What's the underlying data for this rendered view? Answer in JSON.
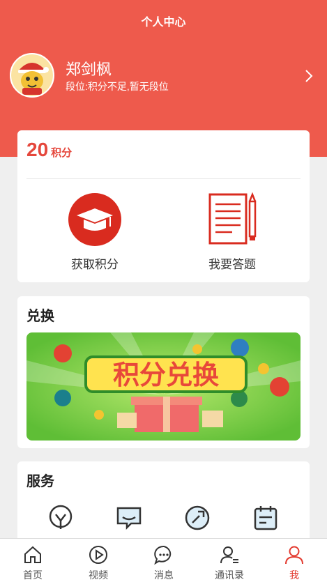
{
  "header": {
    "title": "个人中心"
  },
  "profile": {
    "name": "郑剑枫",
    "level_text": "段位:积分不足,暂无段位"
  },
  "points": {
    "value": "20",
    "unit": "积分",
    "actions": [
      {
        "label": "获取积分",
        "icon": "graduation-cap-icon"
      },
      {
        "label": "我要答题",
        "icon": "answer-sheet-icon"
      }
    ]
  },
  "exchange": {
    "title": "兑换",
    "banner_text": "积分兑换"
  },
  "service": {
    "title": "服务",
    "icons": [
      "lightbulb-icon",
      "message-icon",
      "wrench-icon",
      "calendar-icon"
    ]
  },
  "tabbar": {
    "items": [
      {
        "label": "首页",
        "icon": "home-icon"
      },
      {
        "label": "视频",
        "icon": "play-icon"
      },
      {
        "label": "消息",
        "icon": "chat-icon"
      },
      {
        "label": "通讯录",
        "icon": "contacts-icon"
      },
      {
        "label": "我",
        "icon": "user-icon"
      }
    ],
    "active_index": 4
  },
  "colors": {
    "brand": "#ee5a4c",
    "accent_red": "#e33b30",
    "banner_green": "#7fd04a"
  }
}
